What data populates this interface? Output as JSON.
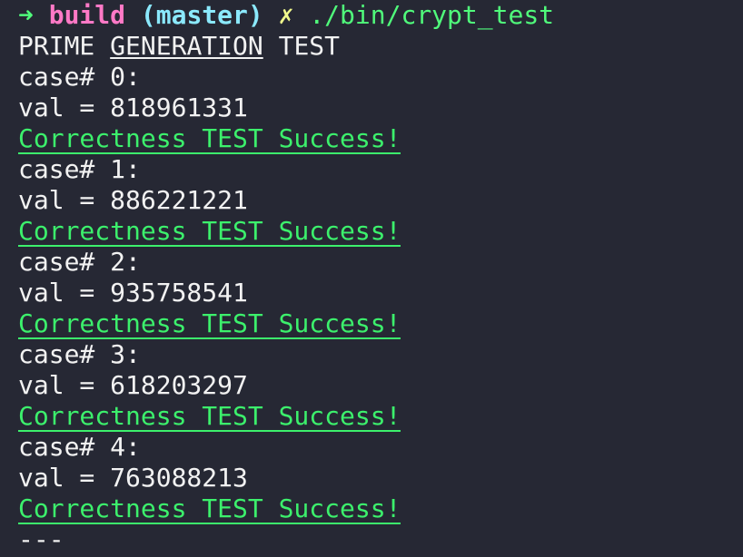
{
  "prompt": {
    "arrow": "➜",
    "dir": "build",
    "branch": "(master)",
    "dirty": "✗",
    "command": "./bin/crypt_test"
  },
  "header": {
    "word1": "PRIME",
    "word2": "GENERATION",
    "word3": "TEST"
  },
  "cases": [
    {
      "label": "case# 0:",
      "val": "val = 818961331",
      "result": "Correctness TEST Success!"
    },
    {
      "label": "case# 1:",
      "val": "val = 886221221",
      "result": "Correctness TEST Success!"
    },
    {
      "label": "case# 2:",
      "val": "val = 935758541",
      "result": "Correctness TEST Success!"
    },
    {
      "label": "case# 3:",
      "val": "val = 618203297",
      "result": "Correctness TEST Success!"
    },
    {
      "label": "case# 4:",
      "val": "val = 763088213",
      "result": "Correctness TEST Success!"
    }
  ],
  "footer": "---",
  "colors": {
    "background": "#262834",
    "success": "#3cf06c",
    "prompt_arrow": "#50fa7b",
    "prompt_dir": "#ff79c6",
    "prompt_branch": "#8be9fd",
    "prompt_dirty": "#f1fa8c"
  }
}
